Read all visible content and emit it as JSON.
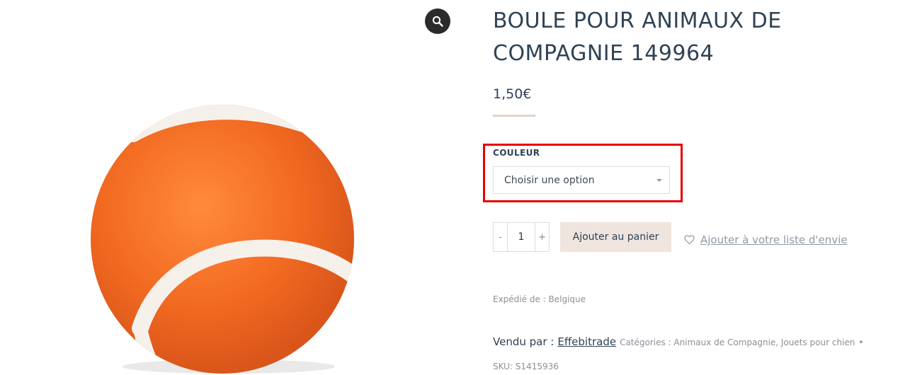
{
  "product": {
    "title_line1": "BOULE POUR ANIMAUX DE",
    "title_line2": "COMPAGNIE 149964",
    "price": "1,50€"
  },
  "variation": {
    "label": "COULEUR",
    "select_value": "Choisir une option"
  },
  "cart": {
    "minus": "-",
    "quantity": "1",
    "plus": "+",
    "add_to_cart": "Ajouter au panier",
    "wishlist": "Ajouter à votre liste d'envie"
  },
  "meta": {
    "shipped_from": "Expédié de : Belgique",
    "sold_by_label": "Vendu par :",
    "vendor": "Effebitrade",
    "categories": "Catégories : Animaux de Compagnie, Jouets pour chien",
    "separator": "•",
    "sku": "SKU: S1415936"
  },
  "icons": {
    "zoom": "search-icon",
    "wishlist": "heart-icon",
    "select_caret": "chevron-down-icon"
  },
  "colors": {
    "title": "#2f4255",
    "ball": "#f26a21",
    "highlight_border": "#e60000",
    "add_to_cart_bg": "#efe5de"
  }
}
